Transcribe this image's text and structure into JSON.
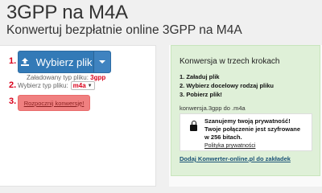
{
  "header": {
    "title": "3GPP na M4A",
    "subtitle": "Konwertuj bezpłatnie online 3GPP na M4A"
  },
  "steps": {
    "n1": "1.",
    "n2": "2.",
    "n3": "3."
  },
  "upload": {
    "label": "Wybierz plik",
    "icon": "upload-icon"
  },
  "loaded": {
    "label": "Załadowany typ pliku:",
    "value": "3gpp"
  },
  "choose": {
    "label": "Wybierz typ pliku:",
    "selected": "m4a"
  },
  "convert": {
    "label": "Rozpocznij konwersję!"
  },
  "right_panel": {
    "title": "Konwersja w trzech krokach",
    "steps": [
      "1. Załaduj plik",
      "2. Wybierz docelowy rodzaj pliku",
      "3. Pobierz plik!"
    ],
    "conversion": "konwersja.3gpp do .m4a",
    "privacy": {
      "line1": "Szanujemy twoją prywatność!",
      "line2": "Twoje połączenie jest szyfrowane",
      "line3": "w 256 bitach.",
      "link": "Polityka prywatności"
    },
    "bookmark": "Dodaj Konwerter-online.pl do zakładek"
  },
  "colors": {
    "accent_blue": "#337ab7",
    "step_red": "#d9001b",
    "convert_button": "#f08080",
    "panel_green": "#dff0d8"
  }
}
